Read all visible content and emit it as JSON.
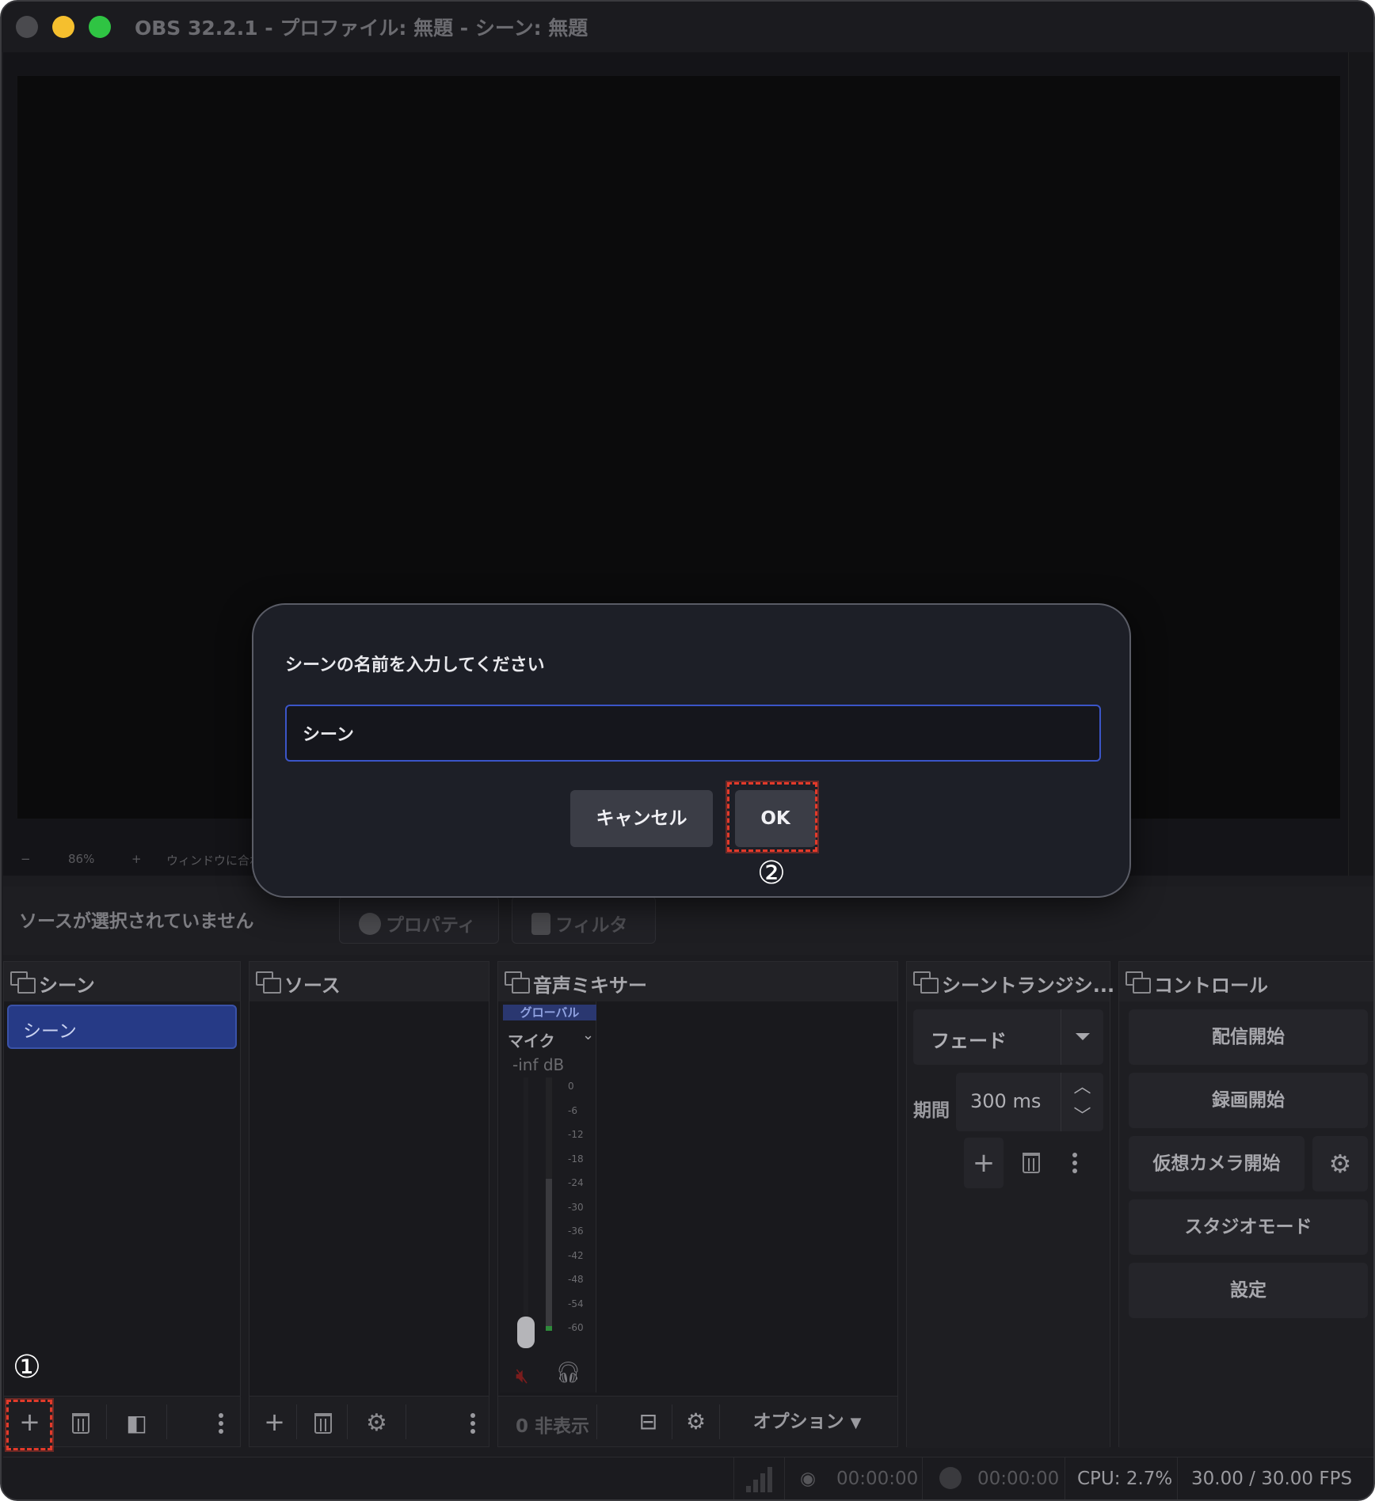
{
  "window": {
    "title": "OBS 32.2.1 - プロファイル: 無題 - シーン: 無題"
  },
  "preview": {
    "zoom_minus": "−",
    "zoom_level": "86%",
    "zoom_plus": "+",
    "fit_label": "ウィンドウに合わせる"
  },
  "source_toolbar": {
    "no_source": "ソースが選択されていません",
    "properties": "プロパティ",
    "filters": "フィルタ"
  },
  "scenes_dock": {
    "title": "シーン",
    "items": [
      "シーン"
    ]
  },
  "sources_dock": {
    "title": "ソース"
  },
  "mixer_dock": {
    "title": "音声ミキサー",
    "global_tag": "グローバル",
    "channel": "マイク",
    "level": "-inf dB",
    "ticks": [
      "0",
      "-6",
      "-12",
      "-18",
      "-24",
      "-30",
      "-36",
      "-42",
      "-48",
      "-54",
      "-60"
    ],
    "hidden": "0 非表示",
    "options": "オプション"
  },
  "transitions_dock": {
    "title": "シーントランジシ...",
    "selected": "フェード",
    "duration_label": "期間",
    "duration": "300 ms"
  },
  "controls_dock": {
    "title": "コントロール",
    "buttons": [
      "配信開始",
      "録画開始",
      "仮想カメラ開始",
      "スタジオモード",
      "設定"
    ]
  },
  "statusbar": {
    "stream_time": "00:00:00",
    "rec_time": "00:00:00",
    "cpu": "CPU: 2.7%",
    "fps": "30.00 / 30.00 FPS"
  },
  "dialog": {
    "prompt": "シーンの名前を入力してください",
    "value": "シーン",
    "cancel": "キャンセル",
    "ok": "OK"
  },
  "annotations": {
    "step1": "①",
    "step2": "②",
    "color": "#e23a2a"
  },
  "icons": [
    "plus-icon",
    "trash-icon",
    "filter-icon",
    "more-dots-icon",
    "gear-icon",
    "mute-icon",
    "headphones-icon",
    "dock-float-icon",
    "signal-icon",
    "record-dot-icon"
  ]
}
